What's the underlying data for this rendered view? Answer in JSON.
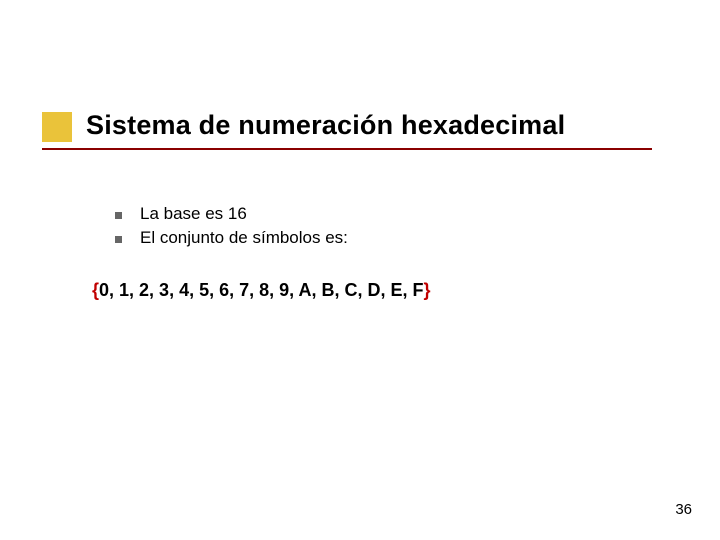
{
  "title": "Sistema de numeración hexadecimal",
  "bullets": [
    "La base es 16",
    "El conjunto de símbolos es:"
  ],
  "set": {
    "open": "{",
    "content": "0, 1, 2, 3, 4, 5, 6, 7, 8, 9, A, B, C, D, E, F",
    "close": "}"
  },
  "page_number": "36"
}
